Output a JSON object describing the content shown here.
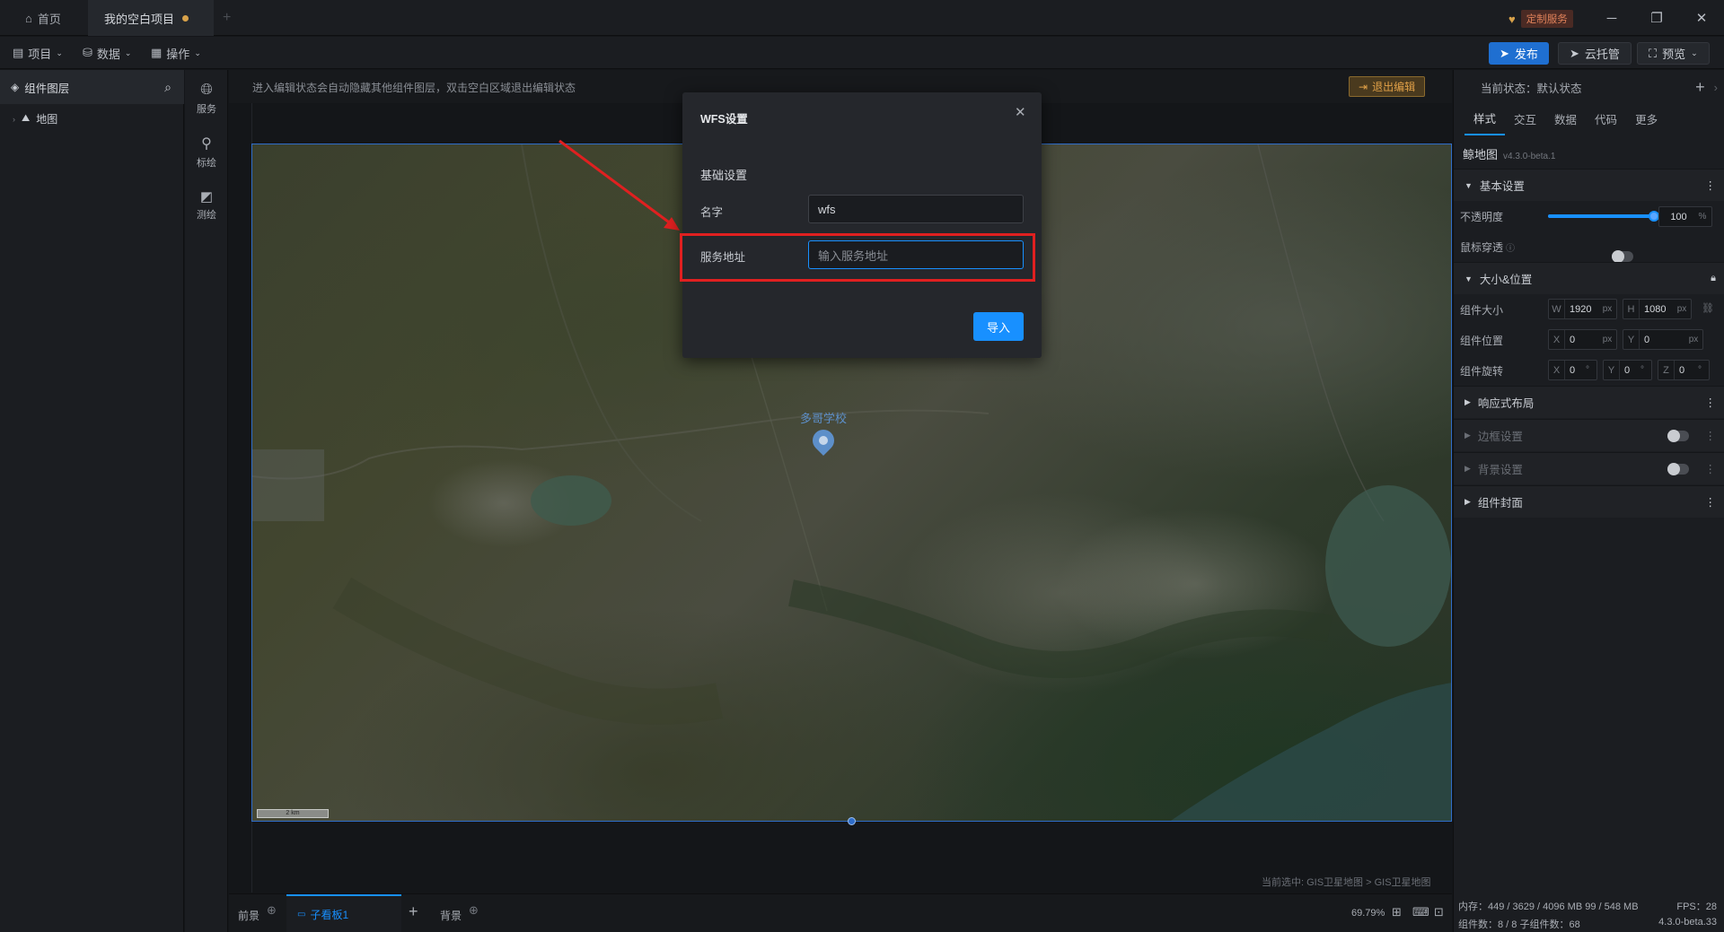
{
  "titlebar": {
    "tabs": [
      {
        "label": "首页"
      },
      {
        "label": "我的空白项目"
      }
    ],
    "custom_service": "定制服务"
  },
  "toolbar": {
    "menus": [
      {
        "label": "项目"
      },
      {
        "label": "数据"
      },
      {
        "label": "操作"
      }
    ],
    "publish": "发布",
    "cloud": "云托管",
    "preview": "预览"
  },
  "layers": {
    "title": "组件图层",
    "items": [
      {
        "label": "地图"
      }
    ]
  },
  "rail": {
    "items": [
      {
        "label": "服务",
        "icon": "globe-icon"
      },
      {
        "label": "标绘",
        "icon": "pin-icon"
      },
      {
        "label": "测绘",
        "icon": "measure-icon"
      }
    ]
  },
  "canvas": {
    "hint": "进入编辑状态会自动隐藏其他组件图层，双击空白区域退出编辑状态",
    "exit_edit": "退出编辑",
    "map_label": "多哥学校",
    "scale_label": "2 km",
    "selection_path": "当前选中: GIS卫星地图 > GIS卫星地图"
  },
  "bottom": {
    "foreground": "前景",
    "panel_tab": "子看板1",
    "background": "背景",
    "zoom": "69.79%"
  },
  "props": {
    "state_label": "当前状态：默认状态",
    "tabs": [
      {
        "label": "样式"
      },
      {
        "label": "交互"
      },
      {
        "label": "数据"
      },
      {
        "label": "代码"
      },
      {
        "label": "更多"
      }
    ],
    "component_name": "鲸地图",
    "version": "v4.3.0-beta.1",
    "basic_section": "基本设置",
    "opacity_label": "不透明度",
    "opacity_value": "100",
    "opacity_unit": "%",
    "opacity_fraction": 1.0,
    "mouse_through_label": "鼠标穿透",
    "size_section": "大小&位置",
    "size_label": "组件大小",
    "size_w_prefix": "W",
    "size_w": "1920",
    "size_h_prefix": "H",
    "size_h": "1080",
    "px_unit": "px",
    "pos_label": "组件位置",
    "pos_x_prefix": "X",
    "pos_x": "0",
    "pos_y_prefix": "Y",
    "pos_y": "0",
    "rot_label": "组件旋转",
    "rot_x": "0",
    "rot_y": "0",
    "rot_z_prefix": "Z",
    "rot_z": "0",
    "deg_unit": "°",
    "responsive_section": "响应式布局",
    "border_section": "边框设置",
    "bg_section": "背景设置",
    "cover_section": "组件封面"
  },
  "status": {
    "memory": "内存：449 / 3629 / 4096 MB  99 / 548 MB",
    "fps": "FPS：28",
    "count": "组件数：8 / 8  子组件数：68",
    "version": "4.3.0-beta.33"
  },
  "modal": {
    "title": "WFS设置",
    "section": "基础设置",
    "name_label": "名字",
    "name_value": "wfs",
    "url_label": "服务地址",
    "url_placeholder": "输入服务地址",
    "import_button": "导入"
  },
  "colors": {
    "accent": "#1890ff",
    "highlight_red": "#e02020",
    "warning_btn": "#4a3a1e"
  }
}
